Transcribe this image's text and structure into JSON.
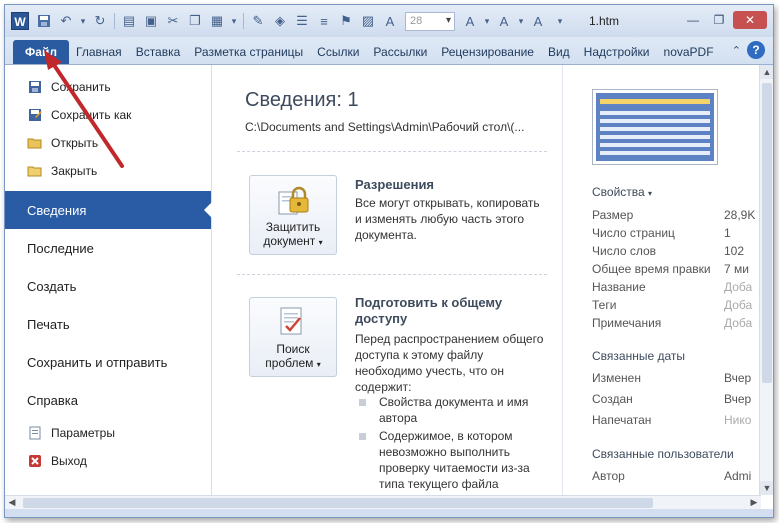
{
  "window": {
    "title": "1.htm",
    "font_size_value": "28",
    "logo_letter": "W"
  },
  "ribbon": {
    "file_tab": "Файл",
    "tabs": [
      "Главная",
      "Вставка",
      "Разметка страницы",
      "Ссылки",
      "Рассылки",
      "Рецензирование",
      "Вид",
      "Надстройки",
      "novaPDF"
    ]
  },
  "left_pane": {
    "commands": [
      {
        "label": "Сохранить",
        "icon": "save-icon"
      },
      {
        "label": "Сохранить как",
        "icon": "save-as-icon"
      },
      {
        "label": "Открыть",
        "icon": "open-folder-icon"
      },
      {
        "label": "Закрыть",
        "icon": "close-folder-icon"
      }
    ],
    "items": [
      "Сведения",
      "Последние",
      "Создать",
      "Печать",
      "Сохранить и отправить",
      "Справка"
    ],
    "active_item": "Сведения",
    "bottom_commands": [
      {
        "label": "Параметры",
        "icon": "options-icon"
      },
      {
        "label": "Выход",
        "icon": "exit-icon"
      }
    ]
  },
  "info": {
    "title": "Сведения: 1",
    "path": "C:\\Documents and Settings\\Admin\\Рабочий стол\\(...",
    "permissions": {
      "button_line1": "Защитить",
      "button_line2": "документ",
      "title": "Разрешения",
      "text": "Все могут открывать, копировать и изменять любую часть этого документа."
    },
    "prepare": {
      "button_line1": "Поиск",
      "button_line2": "проблем",
      "title": "Подготовить к общему доступу",
      "text": "Перед распространением общего доступа к этому файлу необходимо учесть, что он содержит:",
      "bullets": [
        "Свойства документа и имя автора",
        "Содержимое, в котором невозможно выполнить проверку читаемости из-за типа текущего файла"
      ]
    }
  },
  "properties": {
    "heading": "Свойства",
    "rows": [
      {
        "key": "Размер",
        "value": "28,9K",
        "muted": false
      },
      {
        "key": "Число страниц",
        "value": "1",
        "muted": false
      },
      {
        "key": "Число слов",
        "value": "102",
        "muted": false
      },
      {
        "key": "Общее время правки",
        "value": "7 ми",
        "muted": false
      },
      {
        "key": "Название",
        "value": "Доба",
        "muted": true
      },
      {
        "key": "Теги",
        "value": "Доба",
        "muted": true
      },
      {
        "key": "Примечания",
        "value": "Доба",
        "muted": true
      }
    ],
    "dates_heading": "Связанные даты",
    "dates": [
      {
        "key": "Изменен",
        "value": "Вчер"
      },
      {
        "key": "Создан",
        "value": "Вчер"
      },
      {
        "key": "Напечатан",
        "value": "Нико"
      }
    ],
    "people_heading": "Связанные пользователи",
    "people": [
      {
        "key": "Автор",
        "value": "Admi"
      }
    ]
  },
  "colors": {
    "accent": "#2a5ca6",
    "arrow": "#c0282c"
  }
}
